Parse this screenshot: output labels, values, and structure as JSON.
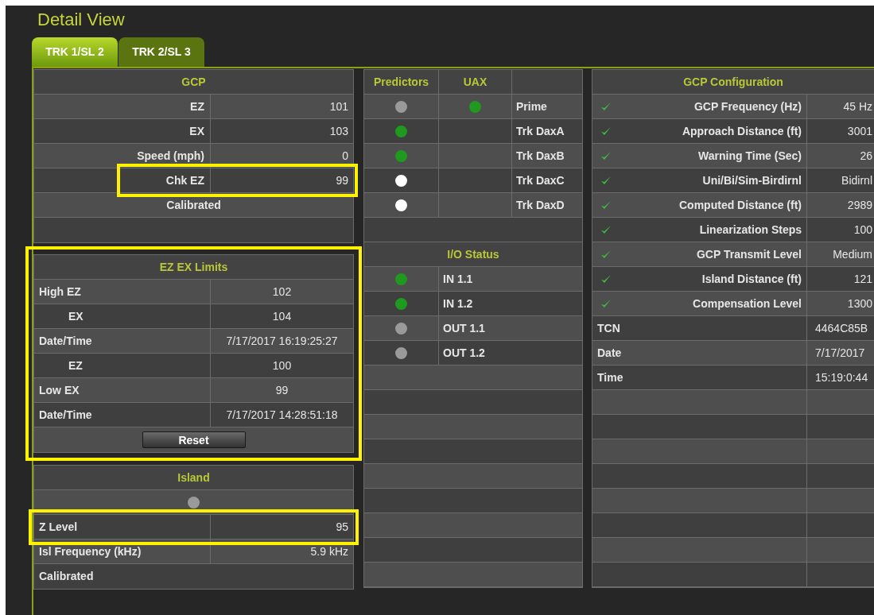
{
  "title": "Detail View",
  "tabs": [
    {
      "label": "TRK 1/SL 2",
      "selected": true
    },
    {
      "label": "TRK 2/SL 3",
      "selected": false
    }
  ],
  "gcp": {
    "title": "GCP",
    "rows": [
      {
        "label": "EZ",
        "value": "101",
        "highlighted": false
      },
      {
        "label": "EX",
        "value": "103",
        "highlighted": false
      },
      {
        "label": "Speed (mph)",
        "value": "0",
        "highlighted": false
      },
      {
        "label": "Chk EZ",
        "value": "99",
        "highlighted": true
      }
    ],
    "status": "Calibrated"
  },
  "limits": {
    "title": "EZ EX Limits",
    "highlighted": true,
    "rows": [
      {
        "label": "High EZ",
        "value": "102",
        "indented": false
      },
      {
        "label": "EX",
        "value": "104",
        "indented": true
      },
      {
        "label": "Date/Time",
        "value": "7/17/2017 16:19:25:27",
        "indented": false
      },
      {
        "label": "EZ",
        "value": "100",
        "indented": true
      },
      {
        "label": "Low EX",
        "value": "99",
        "indented": false
      },
      {
        "label": "Date/Time",
        "value": "7/17/2017 14:28:51:18",
        "indented": false
      }
    ],
    "reset_button": "Reset"
  },
  "island": {
    "title": "Island",
    "indicator": {
      "color": "#9a9a9a"
    },
    "rows": [
      {
        "label": "Z Level",
        "value": "95",
        "highlighted": true
      },
      {
        "label": "Isl Frequency (kHz)",
        "value": "5.9 kHz",
        "highlighted": false
      }
    ],
    "status": "Calibrated"
  },
  "predictors": {
    "columns": [
      "Predictors",
      "UAX"
    ],
    "rows": [
      {
        "predictor": {
          "color": "#9a9a9a"
        },
        "uax": {
          "color": "#1f9a1f"
        },
        "label": "Prime"
      },
      {
        "predictor": {
          "color": "#1f9a1f"
        },
        "label": "Trk DaxA"
      },
      {
        "predictor": {
          "color": "#1f9a1f"
        },
        "label": "Trk DaxB"
      },
      {
        "predictor": {
          "color": "#ffffff"
        },
        "label": "Trk DaxC"
      },
      {
        "predictor": {
          "color": "#ffffff"
        },
        "label": "Trk DaxD"
      }
    ]
  },
  "io_status": {
    "title": "I/O Status",
    "rows": [
      {
        "color": "#1f9a1f",
        "label": "IN 1.1"
      },
      {
        "color": "#1f9a1f",
        "label": "IN 1.2"
      },
      {
        "color": "#9a9a9a",
        "label": "OUT 1.1"
      },
      {
        "color": "#9a9a9a",
        "label": "OUT 1.2"
      }
    ]
  },
  "gcp_configuration": {
    "title": "GCP Configuration",
    "settings": [
      {
        "checked": true,
        "label": "GCP Frequency (Hz)",
        "value": "45 Hz"
      },
      {
        "checked": true,
        "label": "Approach Distance (ft)",
        "value": "3001"
      },
      {
        "checked": true,
        "label": "Warning Time (Sec)",
        "value": "26"
      },
      {
        "checked": true,
        "label": "Uni/Bi/Sim-Birdirnl",
        "value": "Bidirnl"
      },
      {
        "checked": true,
        "label": "Computed Distance (ft)",
        "value": "2989"
      },
      {
        "checked": true,
        "label": "Linearization Steps",
        "value": "100"
      },
      {
        "checked": true,
        "label": "GCP Transmit Level",
        "value": "Medium"
      },
      {
        "checked": true,
        "label": "Island Distance (ft)",
        "value": "121"
      },
      {
        "checked": true,
        "label": "Compensation Level",
        "value": "1300"
      }
    ],
    "info": [
      {
        "label": "TCN",
        "value": "4464C85B"
      },
      {
        "label": "Date",
        "value": "7/17/2017"
      },
      {
        "label": "Time",
        "value": "15:19:0:44"
      }
    ]
  }
}
